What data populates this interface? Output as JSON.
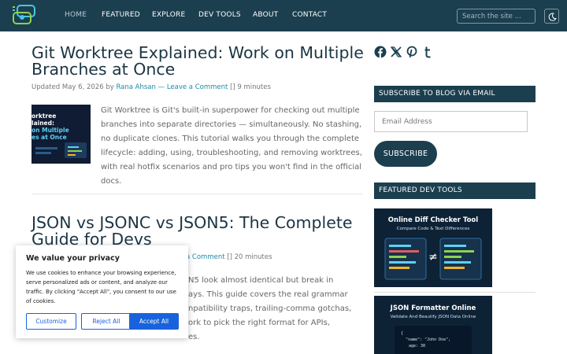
{
  "nav": {
    "items": [
      {
        "label": "HOME",
        "active": true
      },
      {
        "label": "FEATURED"
      },
      {
        "label": "EXPLORE"
      },
      {
        "label": "DEV TOOLS"
      },
      {
        "label": "ABOUT"
      },
      {
        "label": "CONTACT"
      }
    ],
    "search_placeholder": "Search the site ..."
  },
  "posts": [
    {
      "title_lines": [
        "Git Worktree Explained: Work on Multiple",
        "Branches at Once"
      ],
      "meta": {
        "updated": "Updated May 6, 2026",
        "by": "by",
        "author": "Rana Ahsan",
        "sep": "—",
        "comment": "Leave a Comment",
        "read_time": "[] 9 minutes"
      },
      "thumb_lines": [
        "orktree",
        "lained:",
        "on Multiple",
        "es at Once"
      ],
      "excerpt_lines": [
        "Git Worktree is Git's built-in superpower for checking out multiple",
        "branches into separate directories — simultaneously. No stashing,",
        "no duplicate clones. This tutorial walks you through the complete",
        "lifecycle: adding, using, troubleshooting, and removing worktrees,",
        "with real hotfix scenarios and pro tips you won't find in the official",
        "docs."
      ]
    },
    {
      "title_lines": [
        "JSON vs JSONC vs JSON5: The Complete",
        "Guide for Devs"
      ],
      "meta_partial": {
        "comment": "a Comment",
        "read_time": "[] 20 minutes"
      },
      "excerpt_partial_lines": [
        "N5 look almost identical but break in",
        "ays. This guide covers the real grammar",
        "npatibility traps, trailing-comma gotchas,",
        "ork to pick the right format for APIs,",
        "es."
      ]
    }
  ],
  "sidebar": {
    "subscribe_title": "SUBSCRIBE TO BLOG VIA EMAIL",
    "email_placeholder": "Email Address",
    "subscribe_label": "SUBSCRIBE",
    "featured_title": "FEATURED DEV TOOLS",
    "tools": [
      {
        "title": "Online Diff Checker Tool",
        "subtitle": "Compare Code & Text Differences"
      },
      {
        "title": "JSON Formatter Online",
        "subtitle": "Validate And Beautify JSON Data Online",
        "code_lines": [
          "{",
          "\"name\": \"John Doe\",",
          "age: 30"
        ]
      }
    ],
    "socials": [
      "facebook-icon",
      "x-icon",
      "pinterest-icon",
      "tumblr-icon"
    ]
  },
  "cookie": {
    "title": "We value your privacy",
    "text_lines": [
      "We use cookies to enhance your browsing experience,",
      "serve personalized ads or content, and analyze our",
      "traffic. By clicking \"Accept All\", you consent to our use",
      "of cookies."
    ],
    "customize": "Customize",
    "reject": "Reject All",
    "accept": "Accept All"
  },
  "colors": {
    "header": "#1b3f4f",
    "accent_link": "#1f8aa6",
    "cookie_blue": "#1863dc"
  }
}
